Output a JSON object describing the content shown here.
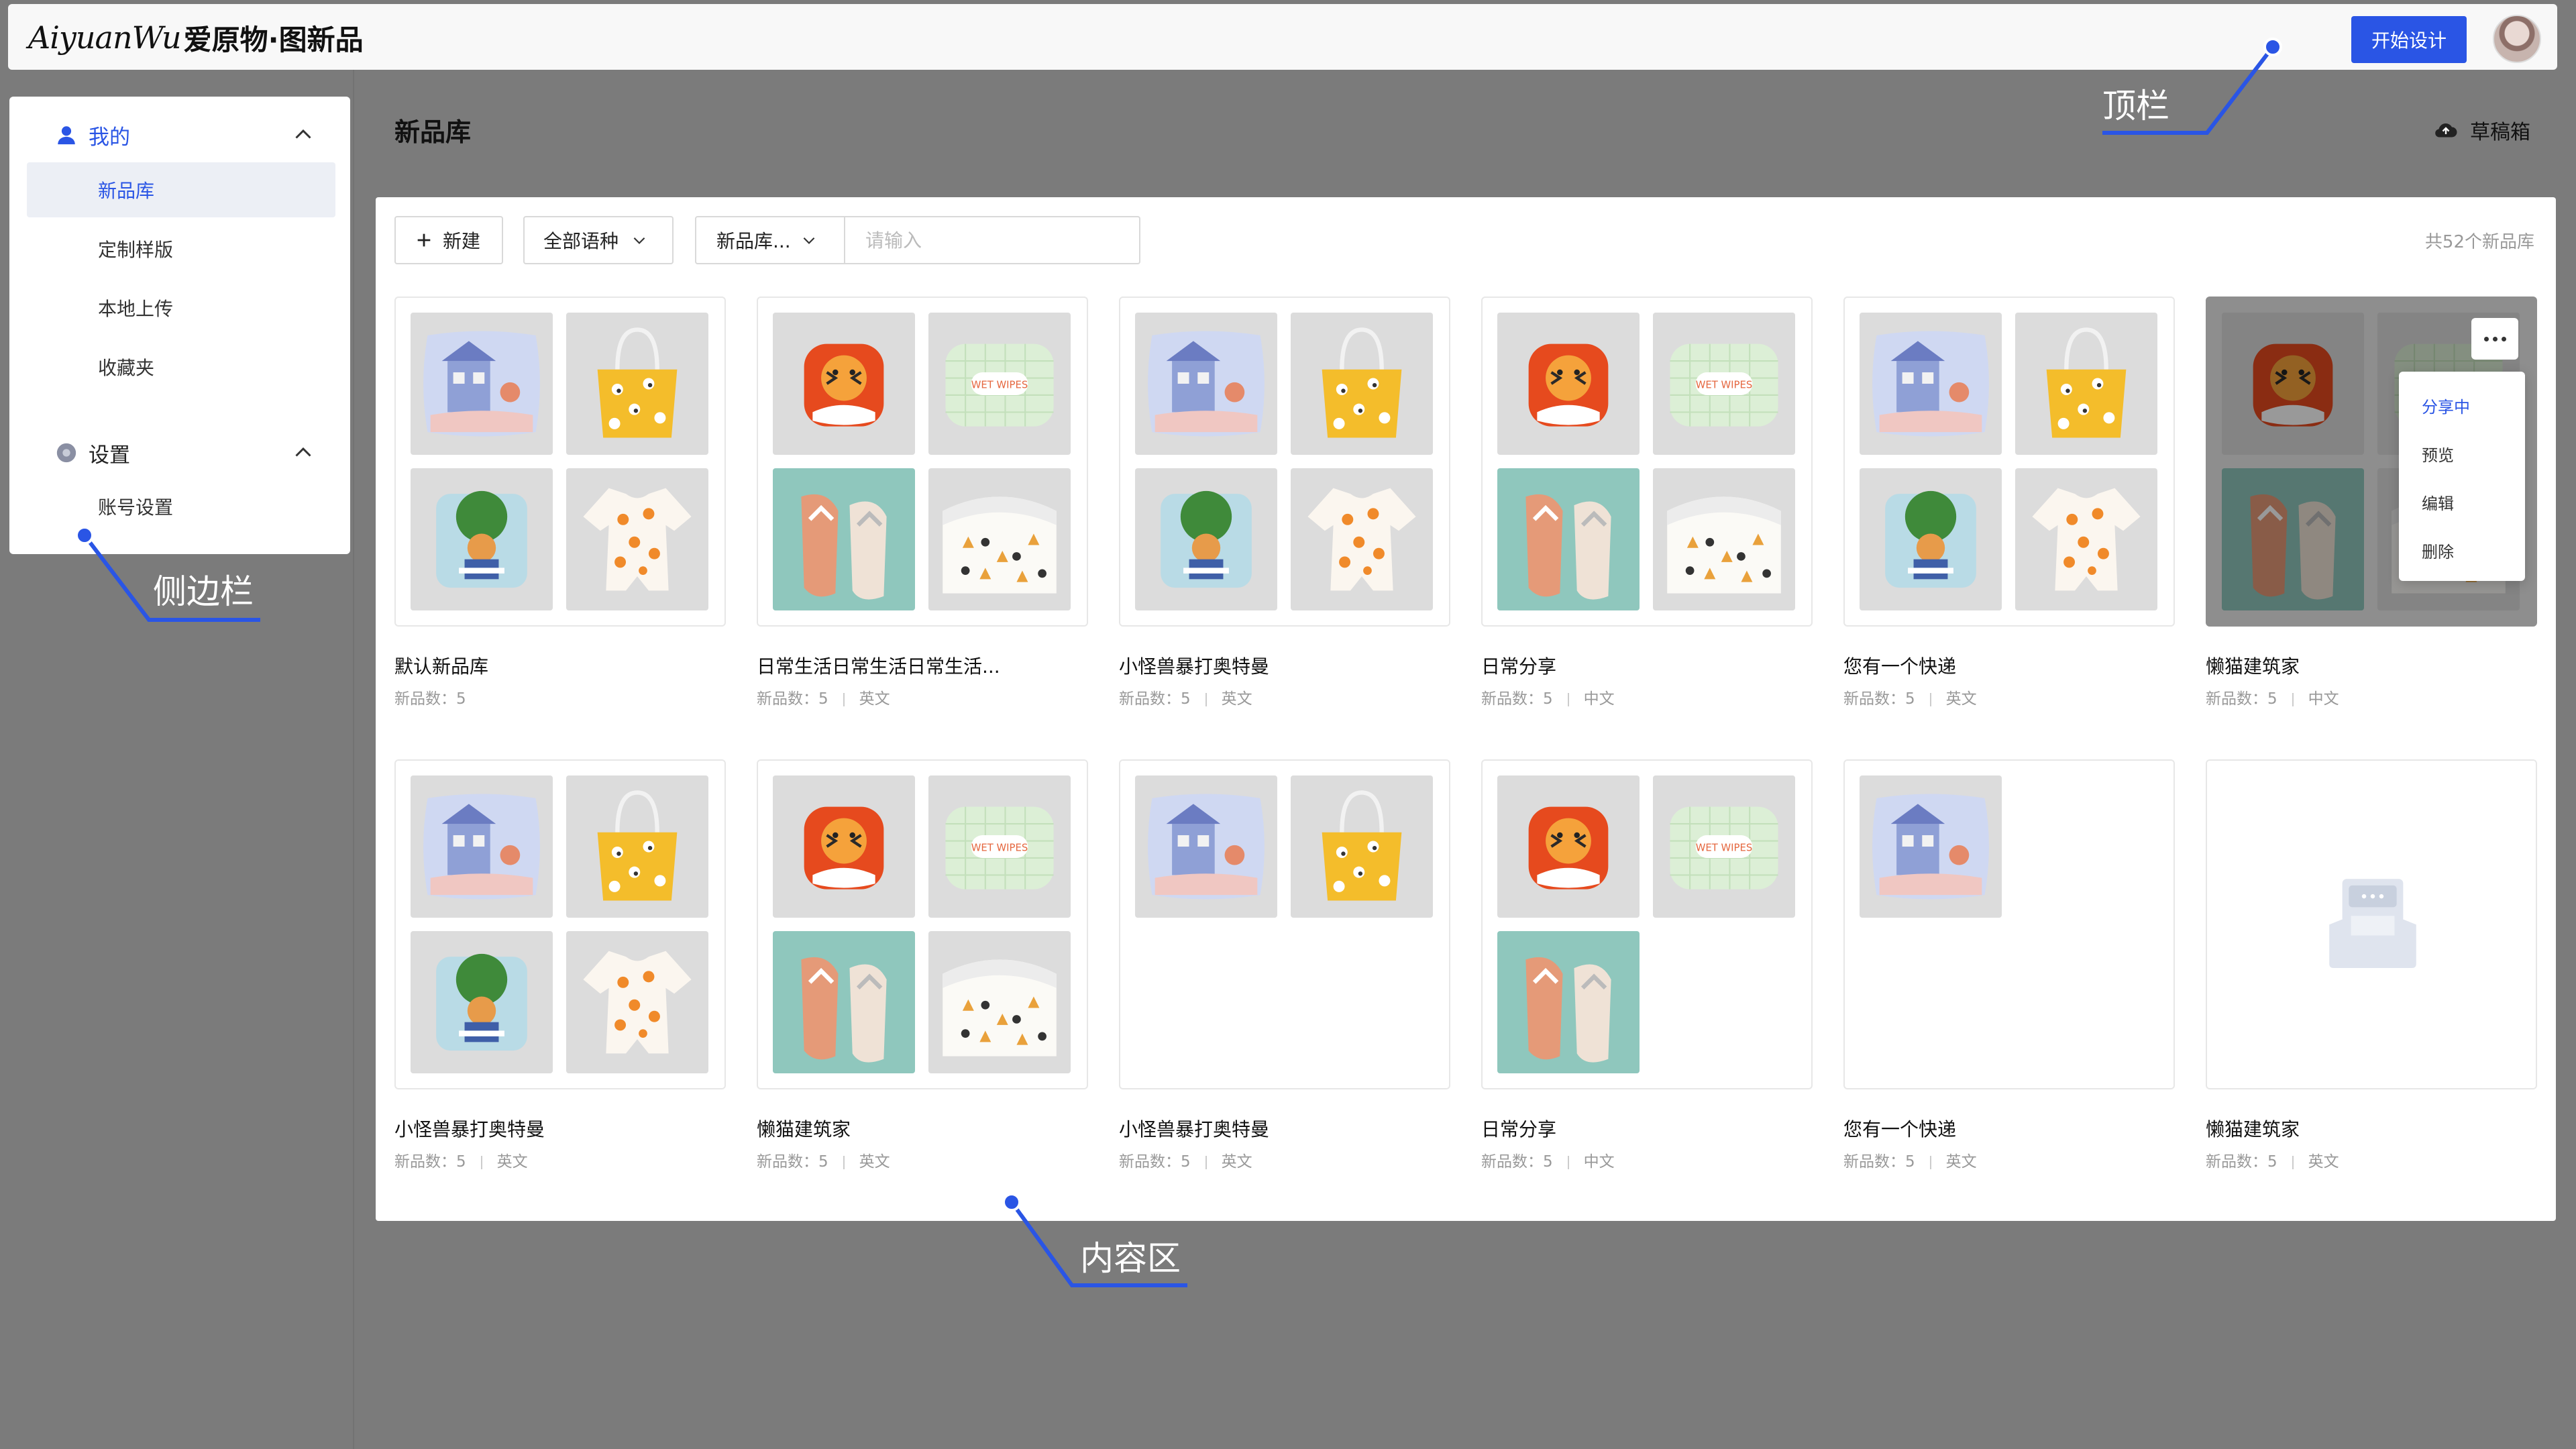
{
  "header": {
    "logo_script": "AiyuanWu",
    "logo_cn": "爱原物·图新品",
    "start_button": "开始设计"
  },
  "sidebar": {
    "groups": [
      {
        "label": "我的",
        "items": [
          "新品库",
          "定制样版",
          "本地上传",
          "收藏夹"
        ]
      },
      {
        "label": "设置",
        "items": [
          "账号设置"
        ]
      }
    ],
    "active_item": "新品库"
  },
  "page": {
    "title": "新品库",
    "drafts": "草稿箱"
  },
  "toolbar": {
    "new_button": "新建",
    "language_filter": "全部语种",
    "search_field_select": "新品库...",
    "search_placeholder": "请输入",
    "total": "共52个新品库"
  },
  "meta_label": "新品数：",
  "cards": [
    {
      "name": "默认新品库",
      "count": "5",
      "lang": "",
      "thumbs": [
        "pillow",
        "bag",
        "phonecase",
        "onesie"
      ]
    },
    {
      "name": "日常生活日常生活日常生活...",
      "count": "5",
      "lang": "英文",
      "thumbs": [
        "airpods",
        "wipes",
        "flipflops",
        "towel"
      ]
    },
    {
      "name": "小怪兽暴打奥特曼",
      "count": "5",
      "lang": "英文",
      "thumbs": [
        "pillow",
        "bag",
        "phonecase",
        "onesie"
      ]
    },
    {
      "name": "日常分享",
      "count": "5",
      "lang": "中文",
      "thumbs": [
        "airpods",
        "wipes",
        "flipflops",
        "towel"
      ]
    },
    {
      "name": "您有一个快递",
      "count": "5",
      "lang": "英文",
      "thumbs": [
        "pillow",
        "bag",
        "phonecase",
        "onesie"
      ]
    },
    {
      "name": "懒猫建筑家",
      "count": "5",
      "lang": "中文",
      "thumbs": [
        "airpods",
        "wipes",
        "flipflops",
        "towel"
      ],
      "hover": true
    },
    {
      "name": "小怪兽暴打奥特曼",
      "count": "5",
      "lang": "英文",
      "thumbs": [
        "pillow",
        "bag",
        "phonecase",
        "onesie"
      ]
    },
    {
      "name": "懒猫建筑家",
      "count": "5",
      "lang": "英文",
      "thumbs": [
        "airpods",
        "wipes",
        "flipflops",
        "towel"
      ]
    },
    {
      "name": "小怪兽暴打奥特曼",
      "count": "5",
      "lang": "英文",
      "thumbs": [
        "pillow",
        "bag"
      ]
    },
    {
      "name": "日常分享",
      "count": "5",
      "lang": "中文",
      "thumbs": [
        "airpods",
        "wipes",
        "flipflops"
      ]
    },
    {
      "name": "您有一个快递",
      "count": "5",
      "lang": "英文",
      "thumbs": [
        "pillow"
      ]
    },
    {
      "name": "懒猫建筑家",
      "count": "5",
      "lang": "英文",
      "thumbs": [],
      "empty": true
    }
  ],
  "card_menu": [
    "分享中",
    "预览",
    "编辑",
    "删除"
  ],
  "wipes_label": "WET WIPES",
  "annotations": {
    "topbar": "顶栏",
    "sidebar": "侧边栏",
    "content": "内容区"
  },
  "colors": {
    "accent": "#2a55e5",
    "backdrop": "#7b7b7b",
    "annotation_line": "#2a55e5"
  }
}
